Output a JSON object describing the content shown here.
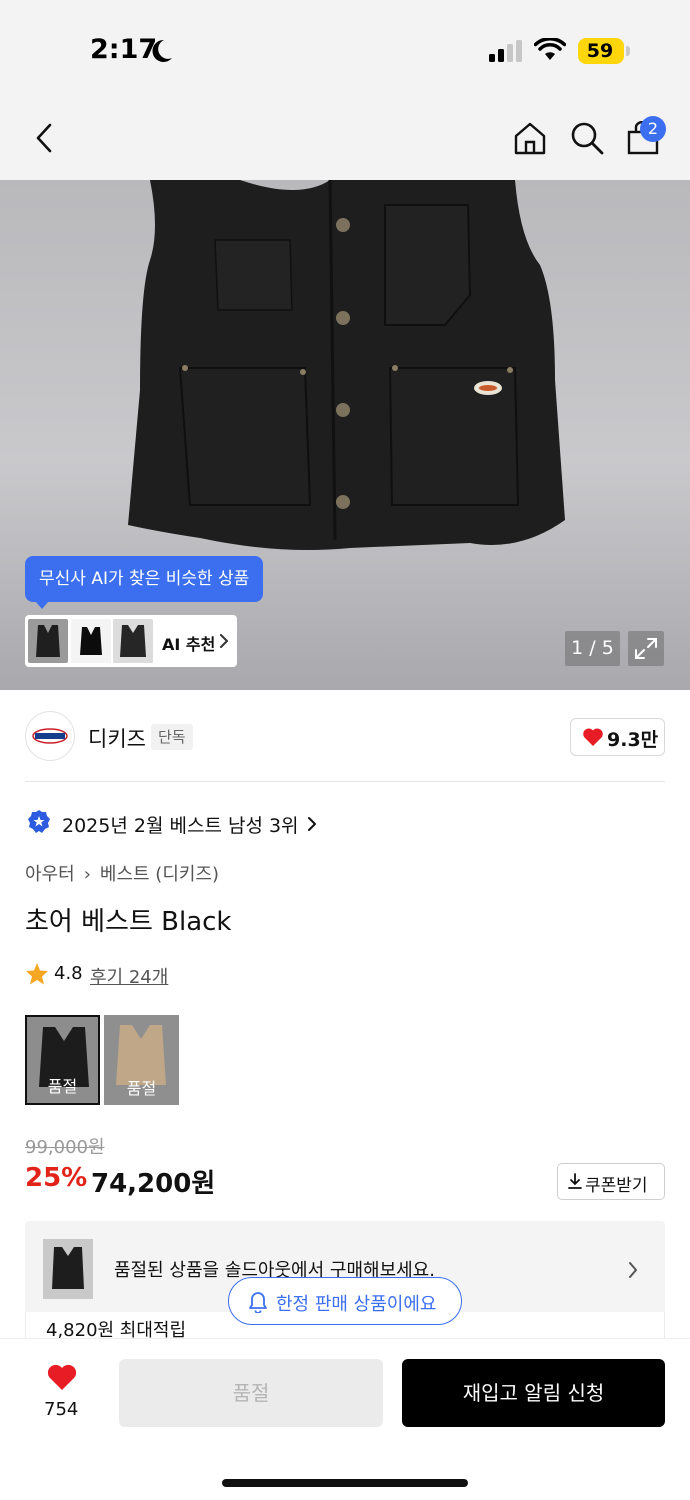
{
  "status_bar": {
    "time": "2:17",
    "battery": "59"
  },
  "nav": {
    "cart_count": "2",
    "icons": [
      "back-icon",
      "home-icon",
      "search-icon",
      "bag-icon"
    ]
  },
  "gallery": {
    "ai_tooltip": "무신사 AI가 찾은 비슷한 상품",
    "ai_recommend": "AI 추천",
    "page_indicator": "1 / 5"
  },
  "brand": {
    "name": "디키즈",
    "tag": "단독",
    "likes": "9.3만"
  },
  "ranking": {
    "text": "2025년 2월 베스트 남성 3위"
  },
  "breadcrumb": [
    "아우터",
    "베스트 (디키즈)"
  ],
  "product": {
    "title": "초어 베스트 Black",
    "rating": "4.8",
    "reviews": "후기 24개",
    "options": [
      {
        "label": "품절",
        "color": "#1c1c1c"
      },
      {
        "label": "품절",
        "color": "#bfa787"
      }
    ]
  },
  "price": {
    "original": "99,000원",
    "discount": "25%",
    "sale": "74,200원",
    "coupon": "쿠폰받기"
  },
  "soldout_banner": {
    "text": "품절된 상품을 솔드아웃에서 구매해보세요.",
    "points": "4,820원 최대적립",
    "limited_pill": "한정 판매 상품이에요"
  },
  "bottom_bar": {
    "wish_count": "754",
    "soldout_label": "품절",
    "restock_label": "재입고 알림 신청"
  },
  "colors": {
    "accent_blue": "#3b6ff0",
    "discount_red": "#e2231a",
    "heart_red": "#e81c24"
  }
}
